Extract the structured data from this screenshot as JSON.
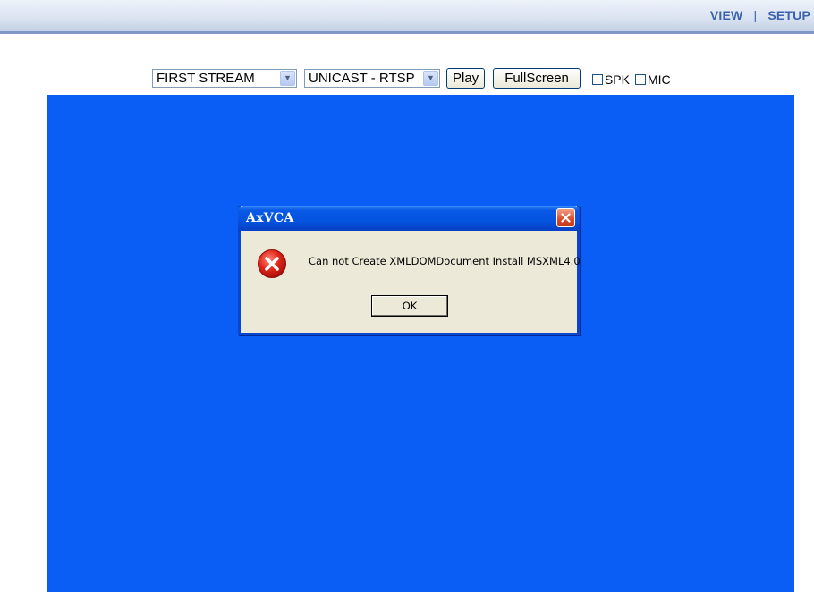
{
  "nav": {
    "view_label": "VIEW",
    "separator": "|",
    "setup_label": "SETUP"
  },
  "controls": {
    "stream_select": {
      "value": "FIRST STREAM",
      "icon": "chevron-down-icon"
    },
    "mode_select": {
      "value": "UNICAST - RTSP",
      "icon": "chevron-down-icon"
    },
    "play_label": "Play",
    "fullscreen_label": "FullScreen",
    "spk_label": "SPK",
    "mic_label": "MIC"
  },
  "dialog": {
    "title": "AxVCA",
    "message": "Can not Create XMLDOMDocument Install MSXML4.0",
    "ok_label": "OK",
    "icon": "error-icon",
    "close_icon": "close-icon"
  },
  "colors": {
    "video_background": "#0a5ef6",
    "nav_text": "#3a62ad",
    "dialog_face": "#ece9d8",
    "titlebar": "#0453e0"
  }
}
